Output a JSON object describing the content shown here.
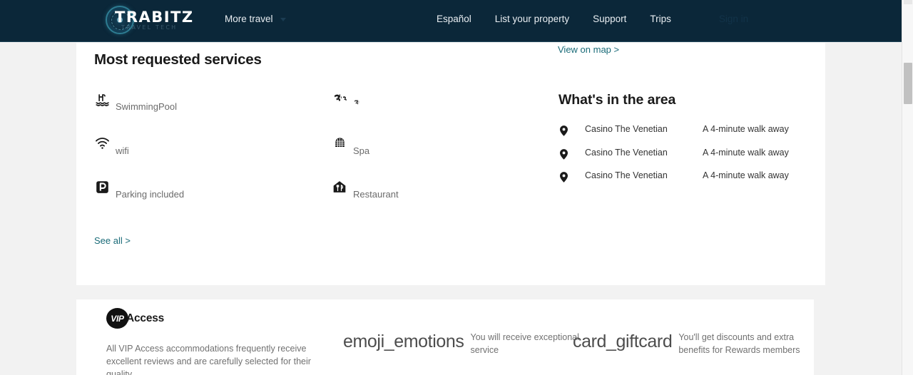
{
  "header": {
    "logo_word": "TRABITZ",
    "logo_sub": "TRAVEL TECH",
    "logo_emblem_icon": "circular-tech-emblem-icon",
    "nav_left": [
      {
        "label": "More travel",
        "icon": "chevron-down-icon"
      }
    ],
    "nav_right": [
      {
        "label": "Español"
      },
      {
        "label": "List your property"
      },
      {
        "label": "Support"
      },
      {
        "label": "Trips"
      }
    ],
    "sign_in_label": "Sign in",
    "background_color": "#0b2739"
  },
  "services": {
    "title": "Most requested services",
    "see_all_label": "See all >",
    "column_1": [
      {
        "icon": "swimming-pool-icon",
        "label": "SwimmingPool"
      },
      {
        "icon": "wifi-icon",
        "label": "wifi"
      },
      {
        "icon": "parking-icon",
        "label": "Parking included"
      }
    ],
    "column_2": [
      {
        "icon": "air-conditioning-icon",
        "label": "ض",
        "is_glyph": true
      },
      {
        "icon": "spa-icon",
        "label": "Spa"
      },
      {
        "icon": "restaurant-icon",
        "label": "Restaurant"
      }
    ]
  },
  "area": {
    "view_on_map_label": "View on map >",
    "title": "What's in the area",
    "items": [
      {
        "icon": "map-pin-icon",
        "name": "Casino The Venetian",
        "distance": "A 4-minute walk away"
      },
      {
        "icon": "map-pin-icon",
        "name": "Casino The Venetian",
        "distance": "A 4-minute walk away"
      },
      {
        "icon": "map-pin-icon",
        "name": "Casino The Venetian",
        "distance": "A 4-minute walk away"
      }
    ]
  },
  "vip": {
    "badge_mark": "VIP",
    "badge_word": "Access",
    "perks": [
      {
        "glyph": "",
        "text": "All VIP Access accommodations frequently receive excellent reviews and are carefully selected for their quality."
      },
      {
        "glyph": "emoji_emotions",
        "text": "You will receive exceptional service"
      },
      {
        "glyph": "card_giftcard",
        "text": "You'll get discounts and extra benefits for Rewards members"
      }
    ]
  },
  "scrollbar": {
    "name": "vertical-scrollbar"
  },
  "colors": {
    "header_bg": "#0b2739",
    "link_teal": "#1a6b78",
    "page_bg": "#f2f2f2",
    "card_bg": "#ffffff"
  }
}
